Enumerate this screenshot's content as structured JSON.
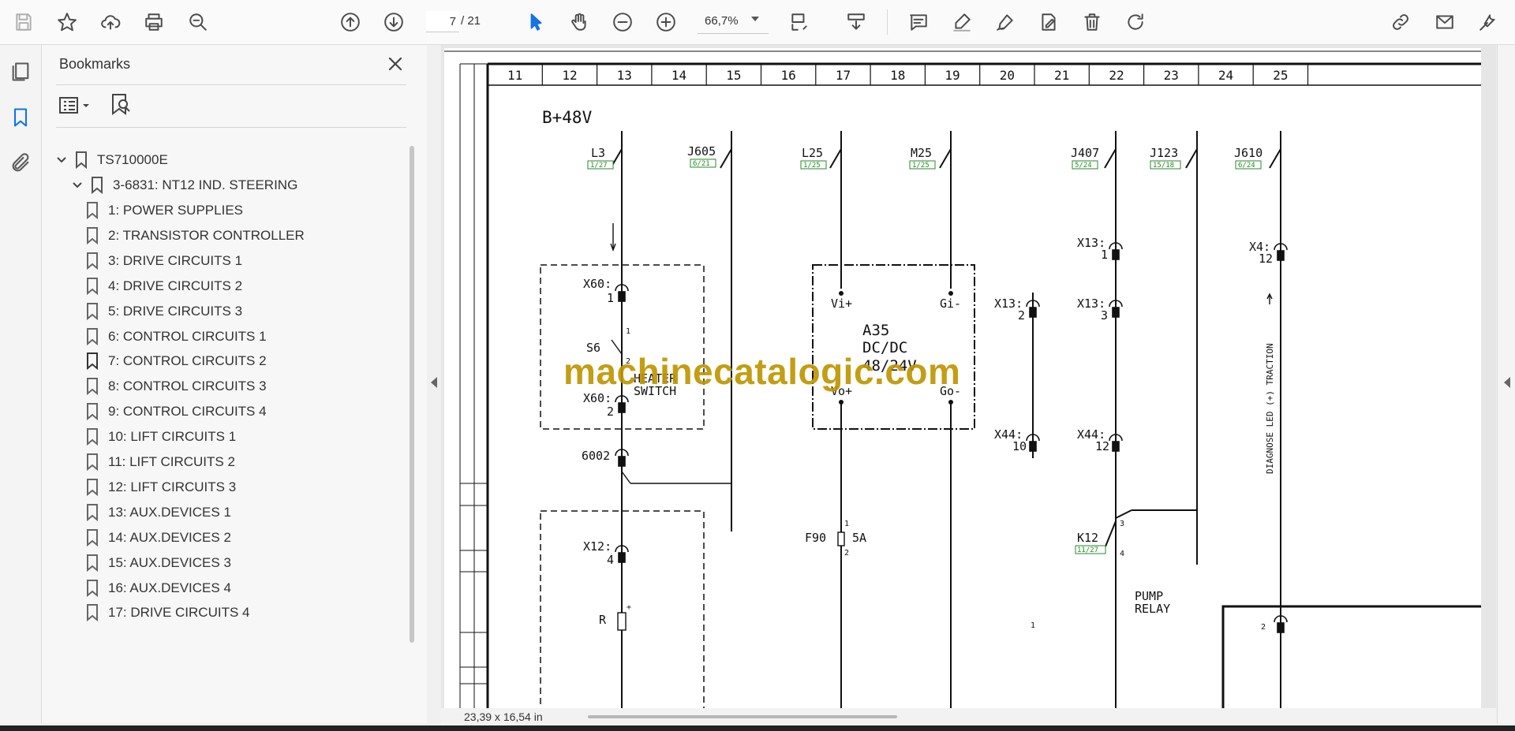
{
  "toolbar": {
    "page_current": "7",
    "page_total": "/ 21",
    "zoom": "66,7%",
    "icons": [
      "save-icon",
      "star-icon",
      "cloud-upload-icon",
      "print-icon",
      "zoom-search-icon",
      "page-up-icon",
      "page-down-icon",
      "select-arrow-icon",
      "hand-icon",
      "zoom-out-icon",
      "zoom-in-icon",
      "fit-page-icon",
      "scroll-mode-icon",
      "comment-icon",
      "highlight-icon",
      "sign-icon",
      "edit-pdf-icon",
      "delete-icon",
      "rotate-icon",
      "share-link-icon",
      "email-icon",
      "more-tools-icon"
    ]
  },
  "left_rail": [
    "pages-icon",
    "bookmarks-icon",
    "attachments-icon"
  ],
  "bookmarks": {
    "title": "Bookmarks",
    "root": "TS710000E",
    "group": "3-6831: NT12 IND. STEERING",
    "items": [
      "1: POWER SUPPLIES",
      "2: TRANSISTOR CONTROLLER",
      "3: DRIVE CIRCUITS 1",
      "4: DRIVE CIRCUITS 2",
      "5: DRIVE CIRCUITS 3",
      "6: CONTROL CIRCUITS 1",
      "7: CONTROL CIRCUITS 2",
      "8: CONTROL CIRCUITS 3",
      "9: CONTROL CIRCUITS 4",
      "10: LIFT CIRCUITS 1",
      "11: LIFT CIRCUITS 2",
      "12: LIFT CIRCUITS 3",
      "13: AUX.DEVICES 1",
      "14: AUX.DEVICES 2",
      "15: AUX.DEVICES 3",
      "16: AUX.DEVICES 4",
      "17: DRIVE CIRCUITS 4"
    ]
  },
  "status": {
    "page_size": "23,39 x 16,54 in"
  },
  "watermark": "machinecatalogic.com",
  "schematic": {
    "columns": [
      "11",
      "12",
      "13",
      "14",
      "15",
      "16",
      "17",
      "18",
      "19",
      "20",
      "21",
      "22",
      "23",
      "24",
      "25"
    ],
    "supply": "B+48V",
    "connectors": [
      {
        "name": "L3",
        "ref": "1/27"
      },
      {
        "name": "J605",
        "ref": "6/21"
      },
      {
        "name": "L25",
        "ref": "1/25"
      },
      {
        "name": "M25",
        "ref": "1/25"
      },
      {
        "name": "J407",
        "ref": "5/24"
      },
      {
        "name": "J123",
        "ref": "15/18"
      },
      {
        "name": "J610",
        "ref": "6/24"
      }
    ],
    "labels": {
      "x60_1a": "X60:",
      "x60_1b": "1",
      "x60_2a": "X60:",
      "x60_2b": "2",
      "s6": "S6",
      "pin1": "1",
      "pin2": "2",
      "heater1": "HEATER",
      "heater2": "SWITCH",
      "node6002": "6002",
      "x12a": "X12:",
      "x12b": "4",
      "r": "R",
      "plus": "+",
      "vi": "Vi+",
      "gi": "Gi-",
      "vo": "Vo+",
      "go": "Go-",
      "a35": "A35",
      "dcdc": "DC/DC",
      "volt": "48/24V",
      "f90": "F90",
      "f90val": "5A",
      "f90p1": "1",
      "f90p2": "2",
      "x13_2a": "X13:",
      "x13_2b": "2",
      "x44_10a": "X44:",
      "x44_10b": "10",
      "x13_1a": "X13:",
      "x13_1b": "1",
      "x13_3a": "X13:",
      "x13_3b": "3",
      "x44_12a": "X44:",
      "x44_12b": "12",
      "k12": "K12",
      "k12ref": "11/27",
      "k12p3": "3",
      "k12p4": "4",
      "pump1": "PUMP",
      "pump2": "RELAY",
      "x4a": "X4:",
      "x4b": "12",
      "diag": "DIAGNOSE LED (+) TRACTION",
      "bottom1": "1",
      "bottom2": "2"
    }
  }
}
